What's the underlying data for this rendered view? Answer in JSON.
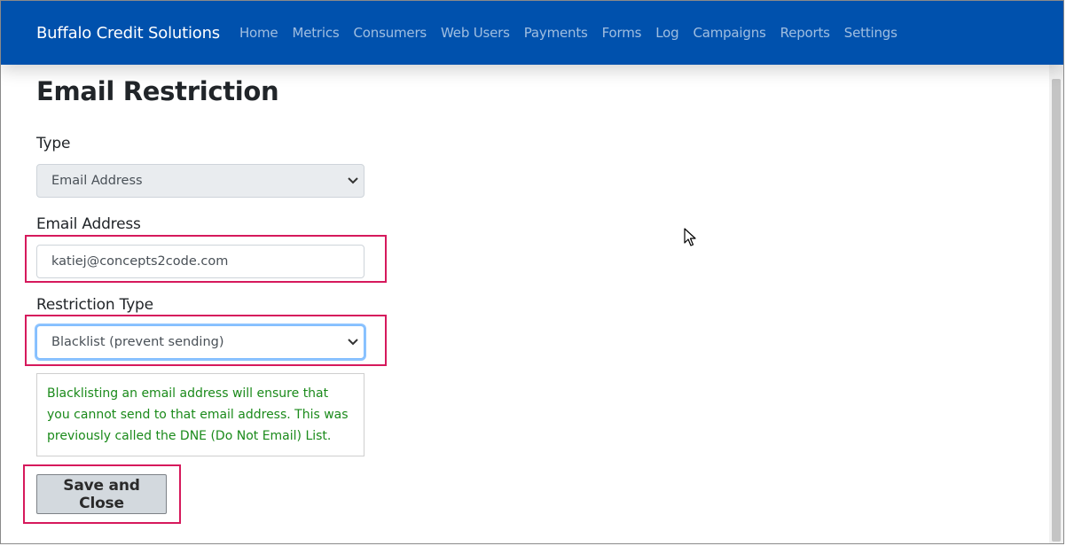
{
  "navbar": {
    "brand": "Buffalo Credit Solutions",
    "links": [
      "Home",
      "Metrics",
      "Consumers",
      "Web Users",
      "Payments",
      "Forms",
      "Log",
      "Campaigns",
      "Reports",
      "Settings"
    ]
  },
  "page": {
    "title": "Email Restriction"
  },
  "form": {
    "type_label": "Type",
    "type_value": "Email Address",
    "email_label": "Email Address",
    "email_value": "katiej@concepts2code.com",
    "restriction_label": "Restriction Type",
    "restriction_value": "Blacklist (prevent sending)",
    "help_text": "Blacklisting an email address will ensure that you cannot send to that email address. This was previously called the DNE (Do Not Email) List.",
    "save_label": "Save and Close"
  },
  "colors": {
    "navbar_bg": "#0051ad",
    "highlight": "#d6195c",
    "help_text": "#1a8a1a"
  },
  "icons": {
    "select_arrow": "chevron-down-icon",
    "cursor": "mouse-pointer-icon"
  }
}
